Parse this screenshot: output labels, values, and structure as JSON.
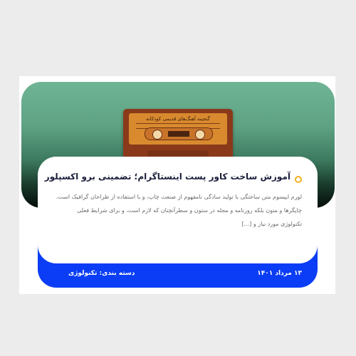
{
  "post": {
    "image_text": "گنجینه آهنگ‌های قدیمی کودکانه",
    "title": "آموزش ساخت کاور پست اینستاگرام؛ تضمینی برو اکسپلور",
    "excerpt": "لورم ایپسوم متن ساختگی با تولید سادگی نامفهوم از صنعت چاپ، و با استفاده از طراحان گرافیک است، چاپگرها و متون بلکه روزنامه و مجله در ستون و سطرآنچنان که لازم است، و برای شرایط فعلی تکنولوژی مورد نیاز و [...]",
    "date": "۱۳ مرداد ۱۴۰۱",
    "category": "دسته بندی: تکنولوژی"
  },
  "colors": {
    "accent": "#0a3df5",
    "bullet": "#f2b01e",
    "title": "#1b1f3b",
    "hero_top": "#6fb595",
    "hero_bottom": "#050d09"
  }
}
